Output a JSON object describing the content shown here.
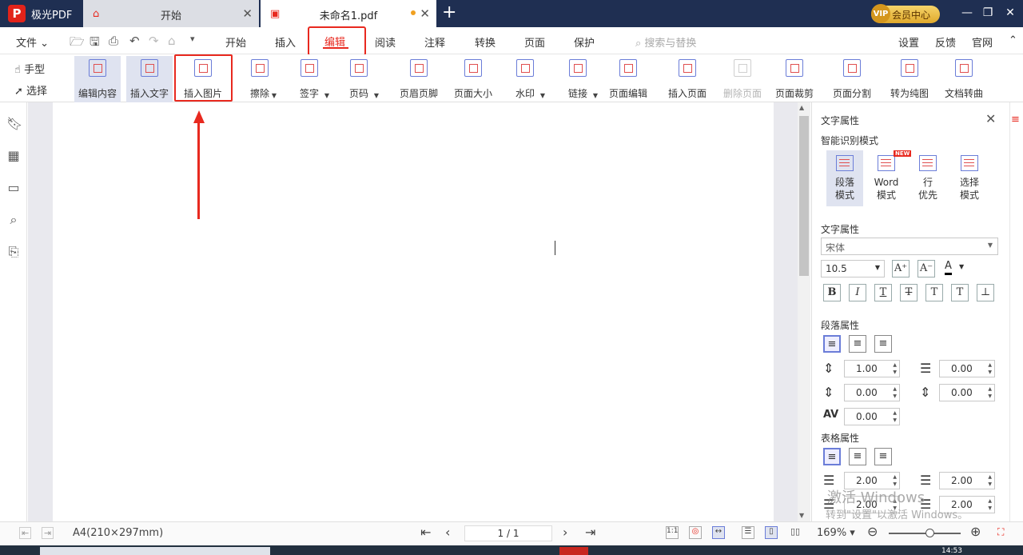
{
  "app": {
    "name": "极光PDF",
    "logo_letter": "P"
  },
  "tabs": [
    {
      "label": "开始"
    },
    {
      "label": "未命名1.pdf"
    }
  ],
  "vip": {
    "badge": "VIP",
    "label": "会员中心"
  },
  "menu": {
    "file": "文件",
    "items": [
      "开始",
      "插入",
      "编辑",
      "阅读",
      "注释",
      "转换",
      "页面",
      "保护"
    ],
    "search_placeholder": "搜索与替换",
    "right": [
      "设置",
      "反馈",
      "官网"
    ]
  },
  "toolbar": {
    "hand": "手型",
    "select": "选择",
    "tools": [
      "编辑内容",
      "插入文字",
      "插入图片",
      "擦除",
      "签字",
      "页码",
      "页眉页脚",
      "页面大小",
      "水印",
      "链接",
      "页面编辑",
      "插入页面",
      "删除页面",
      "页面裁剪",
      "页面分割",
      "转为纯图",
      "文档转曲"
    ]
  },
  "panel": {
    "title": "文字属性",
    "smart_mode": "智能识别模式",
    "modes": [
      {
        "line1": "段落",
        "line2": "模式"
      },
      {
        "line1": "Word",
        "line2": "模式"
      },
      {
        "line1": "行",
        "line2": "优先"
      },
      {
        "line1": "选择",
        "line2": "模式"
      }
    ],
    "new_badge": "NEW",
    "text_props": "文字属性",
    "font": "宋体",
    "size": "10.5",
    "para_props": "段落属性",
    "line_spacing": "1.00",
    "spacing_after": "0.00",
    "spacing_before": "0.00",
    "spacing_below": "0.00",
    "char_spacing": "0.00",
    "table_props": "表格属性",
    "table_left": "2.00",
    "table_right": "2.00",
    "table_top": "2.00",
    "table_bottom": "2.00"
  },
  "status": {
    "page_size": "A4(210×297mm)",
    "page_indicator": "1 / 1",
    "zoom": "169%"
  },
  "watermark": {
    "line1": "激活 Windows",
    "line2": "转到\"设置\"以激活 Windows。"
  },
  "clock": "14:53"
}
